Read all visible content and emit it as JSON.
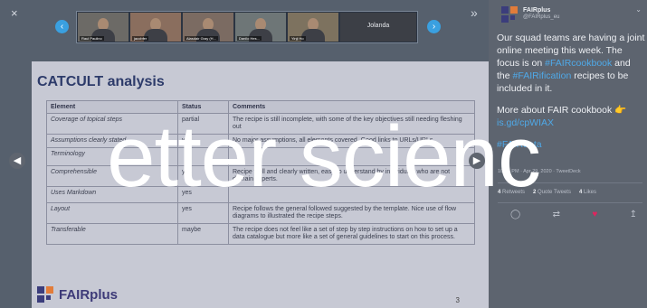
{
  "media": {
    "close_glyph": "×",
    "expand_glyph": "»",
    "prev_glyph": "‹",
    "next_glyph": "›",
    "participants": [
      "Raul Paulino",
      "jacobfer",
      "Alasdair Gray (H...",
      "Danilo Hes...",
      "Yinji Ho"
    ],
    "named_tile": "Jolanda"
  },
  "slide": {
    "title": "CATCULT analysis",
    "headers": [
      "Element",
      "Status",
      "Comments"
    ],
    "rows": [
      {
        "element": "Coverage of topical steps",
        "status": "partial",
        "comment": "The recipe is still incomplete, with some of the key objectives still needing fleshing out"
      },
      {
        "element": "Assumptions clearly stated",
        "status": "yes",
        "comment": "No major assumptions, all elements covered. Good links to URLs/URLs"
      },
      {
        "element": "Terminology",
        "status": "",
        "comment": ""
      },
      {
        "element": "Comprehensible",
        "status": "yes",
        "comment": "Recipe well and clearly written, easy to understand by individuals who are not domain experts."
      },
      {
        "element": "Uses Markdown",
        "status": "yes",
        "comment": ""
      },
      {
        "element": "Layout",
        "status": "yes",
        "comment": "Recipe follows the general followed suggested by the template. Nice use of flow diagrams to illustrated the recipe steps."
      },
      {
        "element": "Transferable",
        "status": "maybe",
        "comment": "The recipe does not feel like a set of step by step instructions on how to set up a data catalogue but more like a set of general guidelines to start on this process."
      }
    ],
    "logo_text": "FAIRplus",
    "page_number": "3"
  },
  "tweet": {
    "name": "FAIRplus",
    "handle": "@FAIRplus_eu",
    "chevron": "⌄",
    "text_1": "Our squad teams are having a joint online meeting this week. The focus is on ",
    "tag_1": "#FAIRcookbook",
    "text_2": " and the ",
    "tag_2": "#FAIRification",
    "text_3": " recipes to be included in it.",
    "more_text": "More about FAIR cookbook 👉 ",
    "more_link": "is.gd/cpWIAX",
    "tag_3": "#FAIRdata",
    "meta": "10:29 PM · Apr 29, 2020 · TweetDeck",
    "retweets_count": "4",
    "retweets_label": "Retweets",
    "quotes_count": "2",
    "quotes_label": "Quote Tweets",
    "likes_count": "4",
    "likes_label": "Likes"
  },
  "overlay_text": "etter scienc",
  "colors": {
    "accent": "#4fa9e8",
    "heart": "#e0245e",
    "slide_title": "#2d3b6a"
  }
}
